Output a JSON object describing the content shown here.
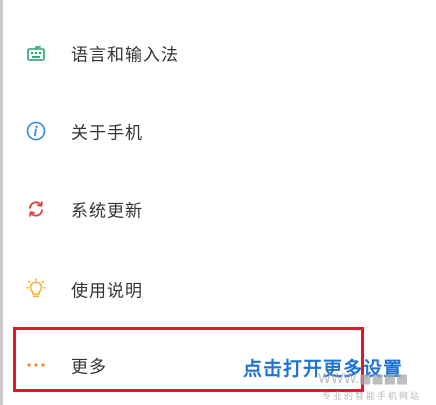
{
  "settings_list": {
    "items": [
      {
        "id": "language",
        "label": "语言和输入法",
        "icon": "keyboard-icon",
        "color": "#22a36a"
      },
      {
        "id": "about",
        "label": "关于手机",
        "icon": "info-icon",
        "color": "#2f8be6"
      },
      {
        "id": "update",
        "label": "系统更新",
        "icon": "refresh-icon",
        "color": "#e83a3a"
      },
      {
        "id": "manual",
        "label": "使用说明",
        "icon": "lightbulb-icon",
        "color": "#f2b32e"
      },
      {
        "id": "more",
        "label": "更多",
        "icon": "more-dots-icon",
        "color": "#f08a2a"
      }
    ]
  },
  "annotation": {
    "text": "点击打开更多设置",
    "color": "#1e74d3",
    "highlight_color": "#e8142a"
  },
  "watermark": {
    "logo_text": "WWW.■■■■",
    "sub_text": "专业的智能手机网站"
  }
}
